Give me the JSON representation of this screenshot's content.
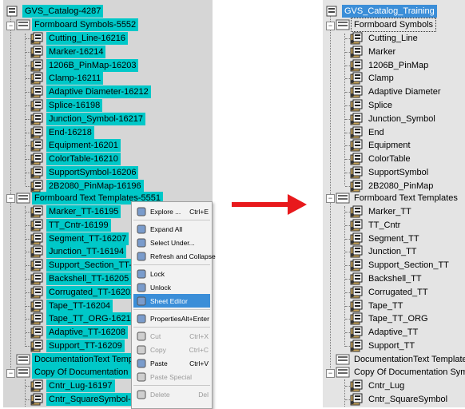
{
  "left_tree": {
    "root": "GVS_Catalog-4287",
    "formboard_symbols": {
      "label": "Formboard Symbols-5552",
      "items": [
        "Cutting_Line-16216",
        "Marker-16214",
        "1206B_PinMap-16203",
        "Clamp-16211",
        "Adaptive Diameter-16212",
        "Splice-16198",
        "Junction_Symbol-16217",
        "End-16218",
        "Equipment-16201",
        "ColorTable-16210",
        "SupportSymbol-16206",
        "2B2080_PinMap-16196"
      ]
    },
    "formboard_text_templates": {
      "label": "Formboard Text Templates-5551",
      "items": [
        "Marker_TT-16195",
        "TT_Cntr-16199",
        "Segment_TT-16207",
        "Junction_TT-16194",
        "Support_Section_TT-16200",
        "Backshell_TT-16205",
        "Corrugated_TT-16202",
        "Tape_TT-16204",
        "Tape_TT_ORG-16213",
        "Adaptive_TT-16208",
        "Support_TT-16209"
      ]
    },
    "documentation_text_templates": "DocumentationText Templates-",
    "copy_of_documentation": {
      "label": "Copy Of Documentation Symbo",
      "items": [
        "Cntr_Lug-16197",
        "Cntr_SquareSymbol-16215"
      ]
    }
  },
  "context_menu": {
    "items": [
      {
        "label": "Explore ...",
        "shortcut": "Ctrl+E",
        "icon": "explore-icon",
        "state": "normal"
      },
      {
        "separator": true
      },
      {
        "label": "Expand All",
        "shortcut": "",
        "icon": "expand-all-icon",
        "state": "normal"
      },
      {
        "label": "Select Under...",
        "shortcut": "",
        "icon": "select-under-icon",
        "state": "normal"
      },
      {
        "label": "Refresh and Collapse",
        "shortcut": "",
        "icon": "refresh-icon",
        "state": "normal"
      },
      {
        "separator": true
      },
      {
        "label": "Lock",
        "shortcut": "",
        "icon": "lock-icon",
        "state": "normal"
      },
      {
        "label": "Unlock",
        "shortcut": "",
        "icon": "unlock-icon",
        "state": "normal"
      },
      {
        "label": "Sheet Editor",
        "shortcut": "",
        "icon": "sheet-editor-icon",
        "state": "active"
      },
      {
        "separator": true
      },
      {
        "label": "Properties",
        "shortcut": "Alt+Enter",
        "icon": "properties-icon",
        "state": "normal"
      },
      {
        "separator": true
      },
      {
        "label": "Cut",
        "shortcut": "Ctrl+X",
        "icon": "cut-icon",
        "state": "disabled"
      },
      {
        "label": "Copy",
        "shortcut": "Ctrl+C",
        "icon": "copy-icon",
        "state": "disabled"
      },
      {
        "label": "Paste",
        "shortcut": "Ctrl+V",
        "icon": "paste-icon",
        "state": "normal"
      },
      {
        "label": "Paste Special",
        "shortcut": "",
        "icon": "paste-special-icon",
        "state": "disabled"
      },
      {
        "separator": true
      },
      {
        "label": "Delete",
        "shortcut": "Del",
        "icon": "delete-icon",
        "state": "disabled"
      }
    ]
  },
  "right_tree": {
    "root": "GVS_Catalog_Training",
    "formboard_symbols": {
      "label": "Formboard Symbols",
      "items": [
        "Cutting_Line",
        "Marker",
        "1206B_PinMap",
        "Clamp",
        "Adaptive Diameter",
        "Splice",
        "Junction_Symbol",
        "End",
        "Equipment",
        "ColorTable",
        "SupportSymbol",
        "2B2080_PinMap"
      ]
    },
    "formboard_text_templates": {
      "label": "Formboard Text Templates",
      "items": [
        "Marker_TT",
        "TT_Cntr",
        "Segment_TT",
        "Junction_TT",
        "Support_Section_TT",
        "Backshell_TT",
        "Corrugated_TT",
        "Tape_TT",
        "Tape_TT_ORG",
        "Adaptive_TT",
        "Support_TT"
      ]
    },
    "documentation_text_templates": "DocumentationText Templates",
    "copy_of_documentation": {
      "label": "Copy Of Documentation Symbols",
      "items": [
        "Cntr_Lug",
        "Cntr_SquareSymbol"
      ]
    }
  },
  "colors": {
    "highlight_cyan": "#00c8c8",
    "selection_blue": "#3b8ed8",
    "arrow_red": "#e8191c"
  }
}
